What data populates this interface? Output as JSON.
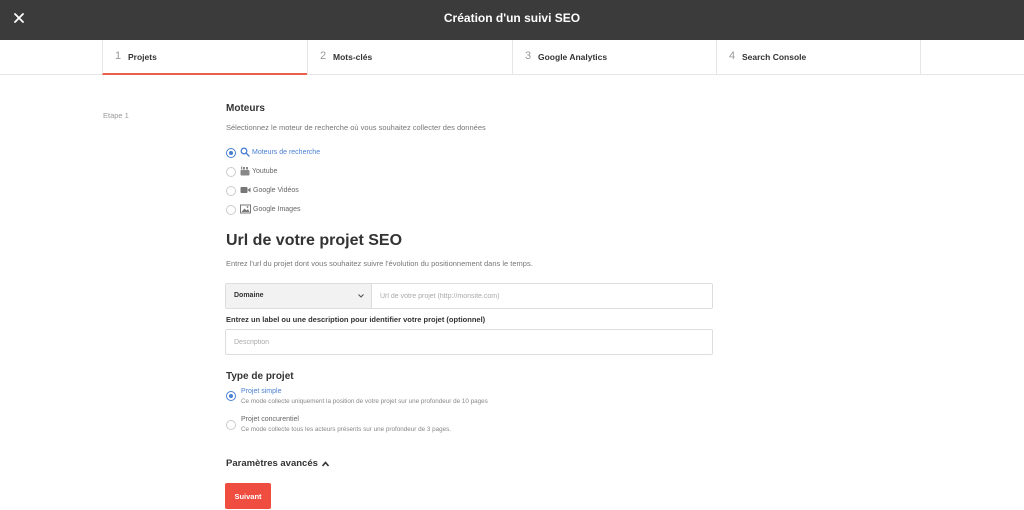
{
  "header": {
    "title": "Création d'un suivi SEO",
    "close_icon": "close-icon",
    "background": "#3b3b3b"
  },
  "steps": [
    {
      "num": "1",
      "label": "Projets",
      "active": true
    },
    {
      "num": "2",
      "label": "Mots-clés",
      "active": false
    },
    {
      "num": "3",
      "label": "Google Analytics",
      "active": false
    },
    {
      "num": "4",
      "label": "Search Console",
      "active": false
    }
  ],
  "etape": "Etape 1",
  "moteurs": {
    "title": "Moteurs",
    "description": "Sélectionnez le moteur de recherche où vous souhaitez collecter des données",
    "options": [
      {
        "label": "Moteurs de recherche",
        "icon": "search-icon",
        "selected": true
      },
      {
        "label": "Youtube",
        "icon": "youtube-icon",
        "selected": false
      },
      {
        "label": "Google Vidéos",
        "icon": "video-camera-icon",
        "selected": false
      },
      {
        "label": "Google Images",
        "icon": "image-icon",
        "selected": false
      }
    ]
  },
  "url_section": {
    "title": "Url de votre projet SEO",
    "description": "Entrez l'url du projet dont vous souhaitez suivre l'évolution du positionnement dans le temps.",
    "select_value": "Domaine",
    "url_placeholder": "Url de votre projet (http://monsite.com)",
    "label_text": "Entrez un label ou une description pour identifier votre projet (optionnel)",
    "label_placeholder": "Description"
  },
  "project_type": {
    "title": "Type de projet",
    "options": [
      {
        "title": "Projet simple",
        "description": "Ce mode collecte uniquement la position de votre projet sur une profondeur de 10 pages",
        "selected": true
      },
      {
        "title": "Projet concurentiel",
        "description": "Ce mode collecte tous les acteurs présents sur une profondeur de 3 pages.",
        "selected": false
      }
    ]
  },
  "advanced_label": "Paramètres avancés",
  "next_button": "Suivant",
  "colors": {
    "accent": "#ef4d3f",
    "active_step_underline": "#e8604c",
    "radio_selected": "#4a7fd1"
  }
}
